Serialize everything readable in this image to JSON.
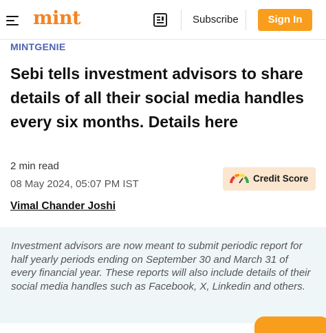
{
  "header": {
    "logo": "mint",
    "subscribe_label": "Subscribe",
    "signin_label": "Sign In"
  },
  "article": {
    "section": "MINTGENIE",
    "headline": "Sebi tells investment advisors to share details of all their social media handles every six months. Details here",
    "read_time": "2 min read",
    "timestamp": "08 May 2024, 05:07 PM IST",
    "author": "Vimal Chander Joshi",
    "summary": "Investment advisors are now meant to submit periodic report for half yearly periods ending on September 30 and March 31 of every financial year. These reports will also include details of their social media handles such as Facebook, X, Linkedin and others."
  },
  "promo": {
    "credit_score_label": "Credit Score",
    "icon": "gauge-icon"
  },
  "colors": {
    "brand": "#f5821f",
    "signin_bg": "#f99d1c",
    "section": "#4d63b1",
    "summary_bg": "#eff6f8",
    "promo_bg": "#fbe6cf"
  }
}
